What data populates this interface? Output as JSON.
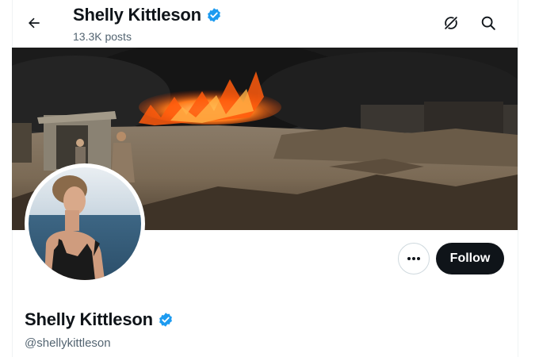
{
  "header": {
    "display_name": "Shelly Kittleson",
    "posts_count": "13.3K posts"
  },
  "profile": {
    "display_name": "Shelly Kittleson",
    "handle": "@shellykittleson",
    "follow_label": "Follow"
  },
  "icons": {
    "back": "arrow-left-icon",
    "grok": "grok-icon",
    "search": "search-icon",
    "verified": "verified-badge-icon",
    "more": "more-icon"
  },
  "colors": {
    "verified": "#1d9bf0",
    "follow_bg": "#0f1419",
    "muted_text": "#536471"
  }
}
